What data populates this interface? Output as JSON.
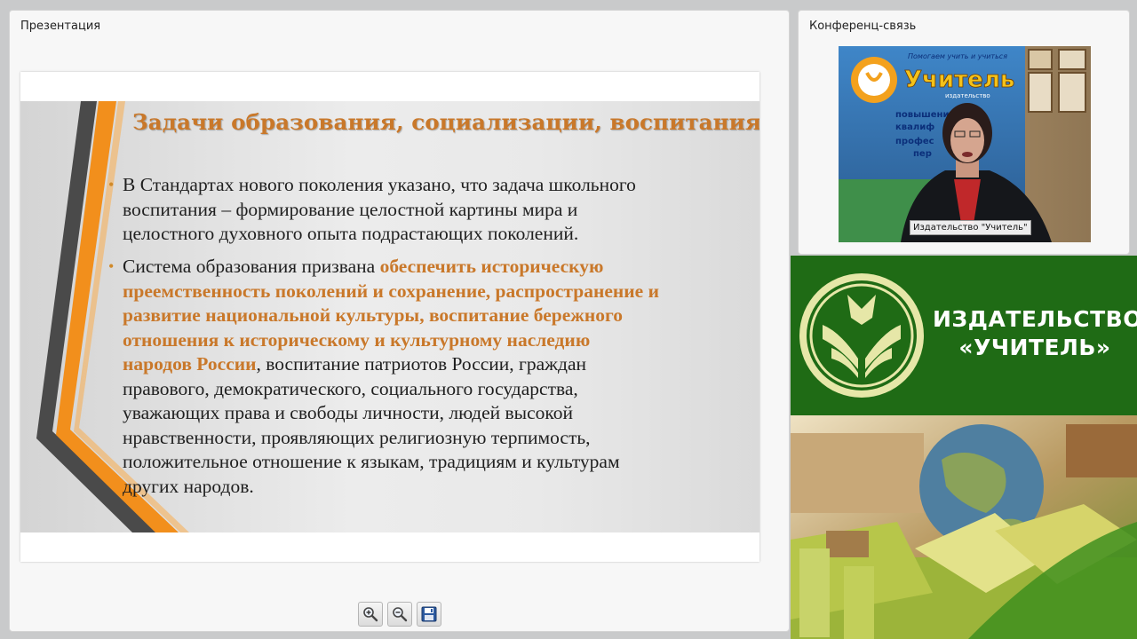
{
  "presentation_panel": {
    "title": "Презентация"
  },
  "conference_panel": {
    "title": "Конференц-связь",
    "video_label": "Издательство \"Учитель\""
  },
  "slide": {
    "title": "Задачи образования, социализации, воспитания",
    "bullet1": "В Стандартах нового поколения указано, что задача школьного\nвоспитания – формирование целостной картины мира и\nцелостного духовного опыта подрастающих поколений.",
    "bullet2_lead": "Система образования призвана ",
    "bullet2_highlight": "обеспечить историческую\nпреемственность поколений и сохранение, распространение и\nразвитие национальной культуры, воспитание бережного\nотношения к историческому и культурному наследию\nнародов России",
    "bullet2_rest": ", воспитание патриотов России, граждан\nправового, демократического, социального государства,\nуважающих права и свободы личности, людей высокой\nнравственности, проявляющих религиозную терпимость,\nположительное отношение к языкам, традициям и культурам\nдругих народов."
  },
  "toolbar": {
    "zoom_in_icon": "zoom-in-icon",
    "zoom_out_icon": "zoom-out-icon",
    "save_icon": "floppy-disk-icon"
  },
  "banner": {
    "name_line1": "ИЗДАТЕЛЬСТВО",
    "name_line2": "«УЧИТЕЛЬ»",
    "colors": {
      "green": "#1f6b15",
      "accent": "#c9782a",
      "logo": "#e6e7a8"
    }
  },
  "video_backdrop": {
    "line1": "Помогаем учить и учиться",
    "line2": "Учитель",
    "line3": "издательство",
    "list": [
      "повышение",
      "квалиф",
      "профес",
      "пер"
    ]
  }
}
